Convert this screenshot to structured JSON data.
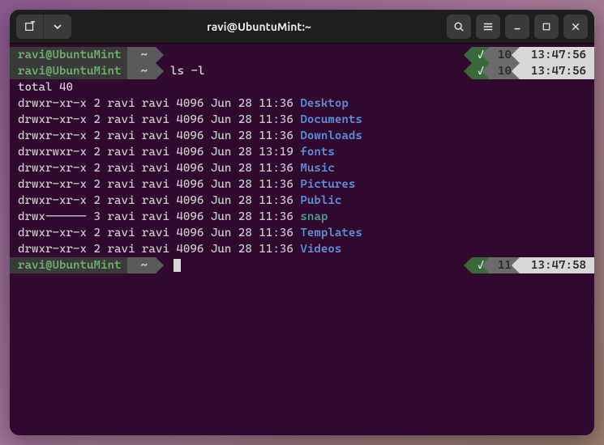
{
  "titlebar": {
    "title": "ravi@UbuntuMint:~"
  },
  "prompts": [
    {
      "user": "ravi@UbuntuMint",
      "path": "~",
      "cmd": "",
      "ok": "✓",
      "num": "10",
      "time": "13:47:56"
    },
    {
      "user": "ravi@UbuntuMint",
      "path": "~",
      "cmd": "ls -l",
      "ok": "✓",
      "num": "10",
      "time": "13:47:56"
    }
  ],
  "total_line": "total 40",
  "listing": [
    {
      "perms": "drwxr-xr-x 2 ravi ravi 4096 Jun 28 11:36 ",
      "name": "Desktop",
      "cls": ""
    },
    {
      "perms": "drwxr-xr-x 2 ravi ravi 4096 Jun 28 11:36 ",
      "name": "Documents",
      "cls": ""
    },
    {
      "perms": "drwxr-xr-x 2 ravi ravi 4096 Jun 28 11:36 ",
      "name": "Downloads",
      "cls": ""
    },
    {
      "perms": "drwxrwxr-x 2 ravi ravi 4096 Jun 28 13:19 ",
      "name": "fonts",
      "cls": ""
    },
    {
      "perms": "drwxr-xr-x 2 ravi ravi 4096 Jun 28 11:36 ",
      "name": "Music",
      "cls": ""
    },
    {
      "perms": "drwxr-xr-x 2 ravi ravi 4096 Jun 28 11:36 ",
      "name": "Pictures",
      "cls": ""
    },
    {
      "perms": "drwxr-xr-x 2 ravi ravi 4096 Jun 28 11:36 ",
      "name": "Public",
      "cls": ""
    },
    {
      "perms": "drwx------ 3 ravi ravi 4096 Jun 28 11:36 ",
      "name": "snap",
      "cls": "alt"
    },
    {
      "perms": "drwxr-xr-x 2 ravi ravi 4096 Jun 28 11:36 ",
      "name": "Templates",
      "cls": ""
    },
    {
      "perms": "drwxr-xr-x 2 ravi ravi 4096 Jun 28 11:36 ",
      "name": "Videos",
      "cls": ""
    }
  ],
  "final_prompt": {
    "user": "ravi@UbuntuMint",
    "path": "~",
    "ok": "✓",
    "num": "11",
    "time": "13:47:58"
  }
}
